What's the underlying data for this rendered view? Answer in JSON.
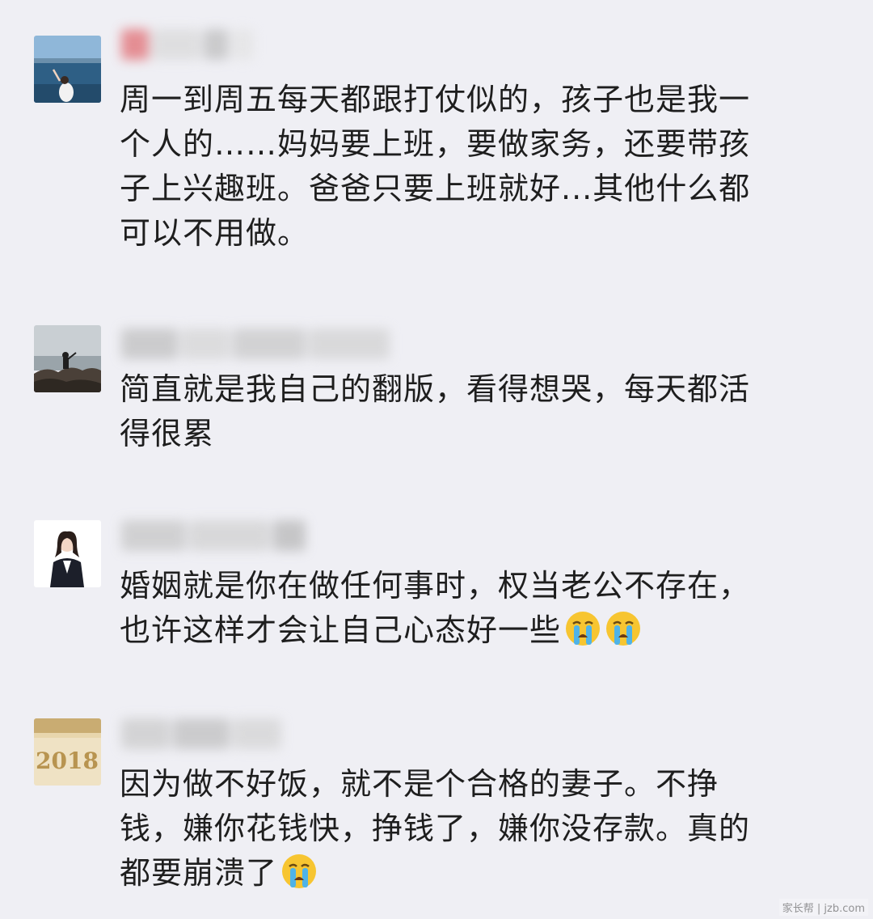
{
  "comments": [
    {
      "avatar": "seaside-photo-avatar",
      "lines": [
        "周一到周五每天都跟打仗似的，孩子也是我一",
        "个人的……妈妈要上班，要做家务，还要带孩",
        "子上兴趣班。爸爸只要上班就好...其他什么都",
        "可以不用做。"
      ]
    },
    {
      "avatar": "rock-shore-photo-avatar",
      "lines": [
        "简直就是我自己的翻版，看得想哭，每天都活",
        "得很累"
      ]
    },
    {
      "avatar": "business-woman-avatar",
      "lines": [
        "婚姻就是你在做任何事时，权当老公不存在，",
        "也许这样才会让自己心态好一些"
      ],
      "emoji_count": 2
    },
    {
      "avatar": "2018-gold-avatar",
      "avatar_text": "2018",
      "lines": [
        "因为做不好饭，就不是个合格的妻子。不挣",
        "钱，嫌你花钱快，挣钱了，嫌你没存款。真的",
        "都要崩溃了"
      ],
      "emoji_count": 1
    }
  ],
  "watermark": "家长帮 | jzb.com",
  "colors": {
    "background": "#efeff4",
    "text": "#1e1e1e",
    "emoji_face": "#f7c531",
    "emoji_tears": "#4fb3e8"
  }
}
